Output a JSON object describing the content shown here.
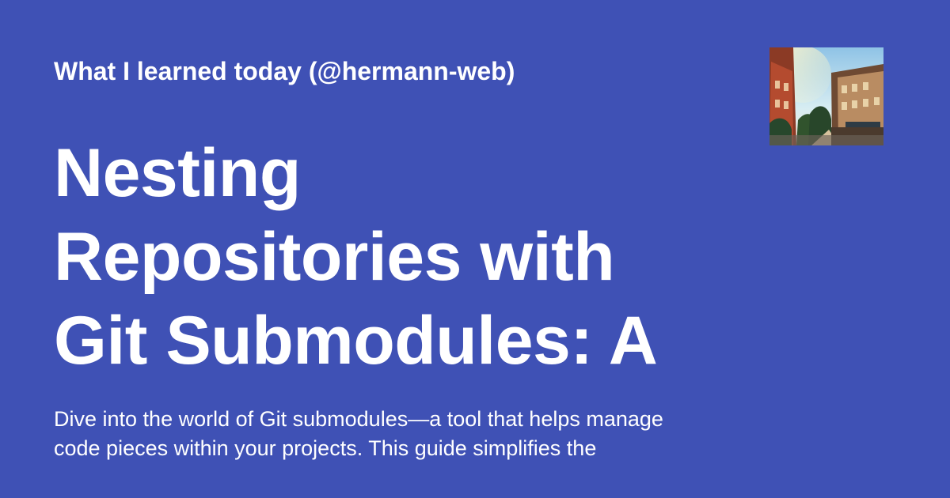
{
  "header": {
    "site_name": "What I learned today (@hermann-web)"
  },
  "article": {
    "title": "Nesting\nRepositories with\nGit Submodules: A",
    "description": "Dive into the world of Git submodules—a tool that helps manage\ncode pieces within your projects. This guide simplifies the"
  },
  "thumbnail": {
    "icon": "street-photo"
  },
  "colors": {
    "background": "#3f51b5",
    "text": "#ffffff"
  }
}
